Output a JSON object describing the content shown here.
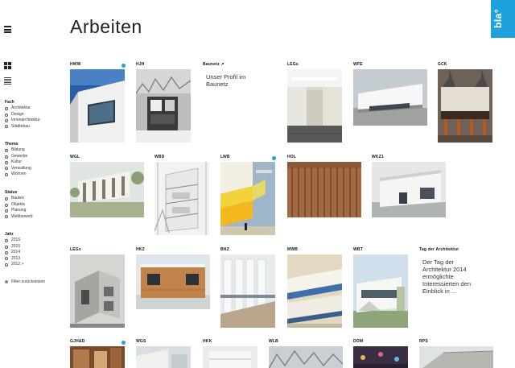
{
  "header": {
    "title": "Arbeiten",
    "logo_text": "bla°",
    "logo_color": "#1fa2dc"
  },
  "menu": {
    "icon": "hamburger-menu-icon"
  },
  "view_toggle": {
    "grid_icon": "grid-view-icon",
    "list_icon": "list-view-icon"
  },
  "filters": {
    "fach": {
      "title": "Fach",
      "options": [
        "Architektur",
        "Design",
        "Innenarchitektur",
        "Städtebau"
      ]
    },
    "thema": {
      "title": "Thema",
      "options": [
        "Bildung",
        "Gewerbe",
        "Kultur",
        "Verwaltung",
        "Wohnen"
      ]
    },
    "status": {
      "title": "Status",
      "options": [
        "Bauten",
        "Objekte",
        "Planung",
        "Wettbewerb"
      ]
    },
    "jahr": {
      "title": "Jahr",
      "options": [
        "2016",
        "2015",
        "2014",
        "2013",
        "2012 >"
      ]
    },
    "reset_label": "Filter zurücksetzen"
  },
  "projects": [
    {
      "label": "HWW",
      "new": true
    },
    {
      "label": "HJH",
      "new": false
    },
    {
      "label": "Baunetz ↗",
      "text": "Unser Profil im Baunetz"
    },
    {
      "label": "LEGs",
      "new": false
    },
    {
      "label": "WFE",
      "new": false
    },
    {
      "label": "GCK",
      "new": false
    },
    {
      "label": "WGL",
      "new": false
    },
    {
      "label": "WBD",
      "new": false
    },
    {
      "label": "LWB",
      "new": true
    },
    {
      "label": "HOL",
      "new": false
    },
    {
      "label": "WKZ1",
      "new": false
    },
    {
      "label": "LEGs",
      "new": false
    },
    {
      "label": "HKZ",
      "new": false
    },
    {
      "label": "BHZ",
      "new": false
    },
    {
      "label": "MWB",
      "new": false
    },
    {
      "label": "WBT",
      "new": false
    },
    {
      "label": "Tag der Architektur",
      "text": "Der Tag der Architektur 2014 ermöglichte Interessierten den Einblick in ..."
    },
    {
      "label": "GJH&D",
      "new": false
    },
    {
      "label": "WGS",
      "new": false
    },
    {
      "label": "HKK",
      "new": false
    },
    {
      "label": "WLB",
      "new": false
    },
    {
      "label": "DOM",
      "new": false
    },
    {
      "label": "RPS",
      "new": false
    }
  ],
  "accent_color": "#1fa2dc"
}
